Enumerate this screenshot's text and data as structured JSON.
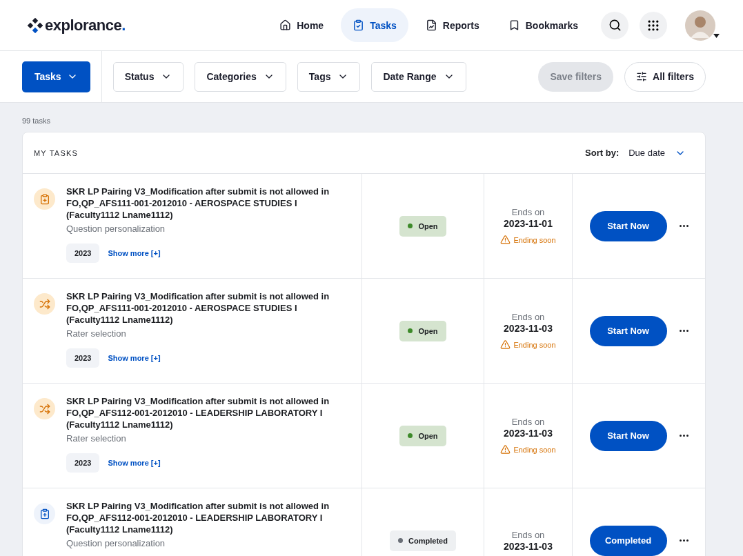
{
  "brand": {
    "name": "explorance",
    "dot": "."
  },
  "nav": [
    {
      "label": "Home",
      "selected": false
    },
    {
      "label": "Tasks",
      "selected": true
    },
    {
      "label": "Reports",
      "selected": false
    },
    {
      "label": "Bookmarks",
      "selected": false
    }
  ],
  "filters": {
    "primary": "Tasks",
    "dropdowns": [
      "Status",
      "Categories",
      "Tags",
      "Date Range"
    ],
    "save": {
      "label": "Save filters",
      "disabled": true
    },
    "all": "All filters"
  },
  "count": "99 tasks",
  "card": {
    "title": "MY TASKS",
    "sort_label": "Sort by:",
    "sort_value": "Due date"
  },
  "tasks": [
    {
      "kind": "questions",
      "title": "SKR LP Pairing V3_Modification after submit is not allowed in FO,QP_AFS111-001-2012010 - AEROSPACE STUDIES I (Faculty1112 Lname1112)",
      "subtitle": "Question personalization",
      "tag": "2023",
      "more": "Show more [+]",
      "status": {
        "kind": "open",
        "label": "Open"
      },
      "ends_label": "Ends on",
      "ends_date": "2023-11-01",
      "warning": "Ending soon",
      "action": "Start Now"
    },
    {
      "kind": "rater",
      "title": "SKR LP Pairing V3_Modification after submit is not allowed in FO,QP_AFS111-001-2012010 - AEROSPACE STUDIES I (Faculty1112 Lname1112)",
      "subtitle": "Rater selection",
      "tag": "2023",
      "more": "Show more [+]",
      "status": {
        "kind": "open",
        "label": "Open"
      },
      "ends_label": "Ends on",
      "ends_date": "2023-11-03",
      "warning": "Ending soon",
      "action": "Start Now"
    },
    {
      "kind": "rater",
      "title": "SKR LP Pairing V3_Modification after submit is not allowed in FO,QP_AFS112-001-2012010 - LEADERSHIP LABORATORY I (Faculty1112 Lname1112)",
      "subtitle": "Rater selection",
      "tag": "2023",
      "more": "Show more [+]",
      "status": {
        "kind": "open",
        "label": "Open"
      },
      "ends_label": "Ends on",
      "ends_date": "2023-11-03",
      "warning": "Ending soon",
      "action": "Start Now"
    },
    {
      "kind": "questions_done",
      "title": "SKR LP Pairing V3_Modification after submit is not allowed in FO,QP_AFS112-001-2012010 - LEADERSHIP LABORATORY I (Faculty1112 Lname1112)",
      "subtitle": "Question personalization",
      "status": {
        "kind": "completed",
        "label": "Completed"
      },
      "ends_label": "Ends on",
      "ends_date": "2023-11-03",
      "action": "Completed"
    }
  ]
}
